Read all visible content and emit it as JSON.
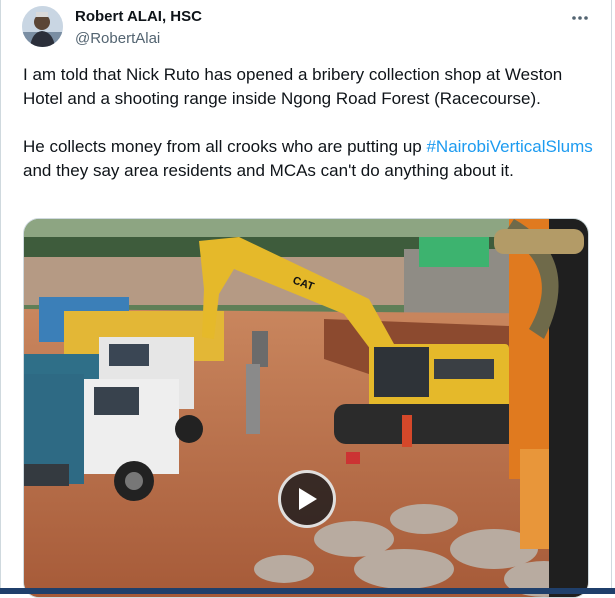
{
  "author": {
    "display_name": "Robert ALAI, HSC",
    "handle": "@RobertAlai",
    "avatar_icon": "profile-photo"
  },
  "menu_icon": "more-horizontal-icon",
  "tweet": {
    "paragraph1": "I am told that Nick Ruto has opened a bribery collection shop at Weston Hotel and a shooting range inside Ngong Road Forest (Racecourse).",
    "paragraph2_before": "He collects money from all crooks who are putting up ",
    "hashtag": "#NairobiVerticalSlums",
    "paragraph2_after": " and they say area residents and MCAs can't do anything about it."
  },
  "media": {
    "type": "video",
    "play_icon": "play-icon",
    "machine_text": "CAT"
  },
  "colors": {
    "link": "#1d9bf0",
    "text": "#0f1419",
    "secondary": "#536471",
    "border": "#cfd9de",
    "excavator_yellow": "#e5b92a",
    "soil": "#b9643c"
  }
}
